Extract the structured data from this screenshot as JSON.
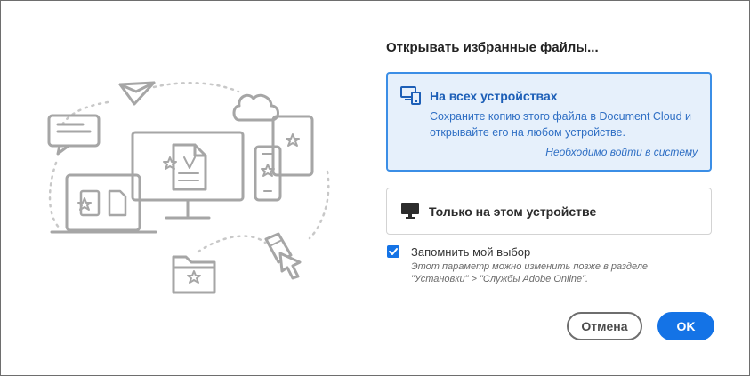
{
  "heading": "Открывать избранные файлы...",
  "options": {
    "all_devices": {
      "title": "На всех устройствах",
      "description": "Сохраните копию этого файла в Document Cloud и открывайте его на любом устройстве.",
      "signin_note": "Необходимо войти в систему",
      "icon": "devices-icon",
      "selected": true
    },
    "this_device": {
      "title": "Только на этом устройстве",
      "icon": "monitor-icon",
      "selected": false
    }
  },
  "remember": {
    "label": "Запомнить мой выбор",
    "checked": true,
    "hint": "Этот параметр можно изменить позже в разделе \"Установки\" > \"Службы Adobe Online\"."
  },
  "buttons": {
    "cancel": "Отмена",
    "ok": "OK"
  },
  "colors": {
    "accent": "#1473e6",
    "selected_bg": "#e6f0fb",
    "selected_border": "#3b8ee6",
    "illustration_gray": "#a6a6a6"
  }
}
